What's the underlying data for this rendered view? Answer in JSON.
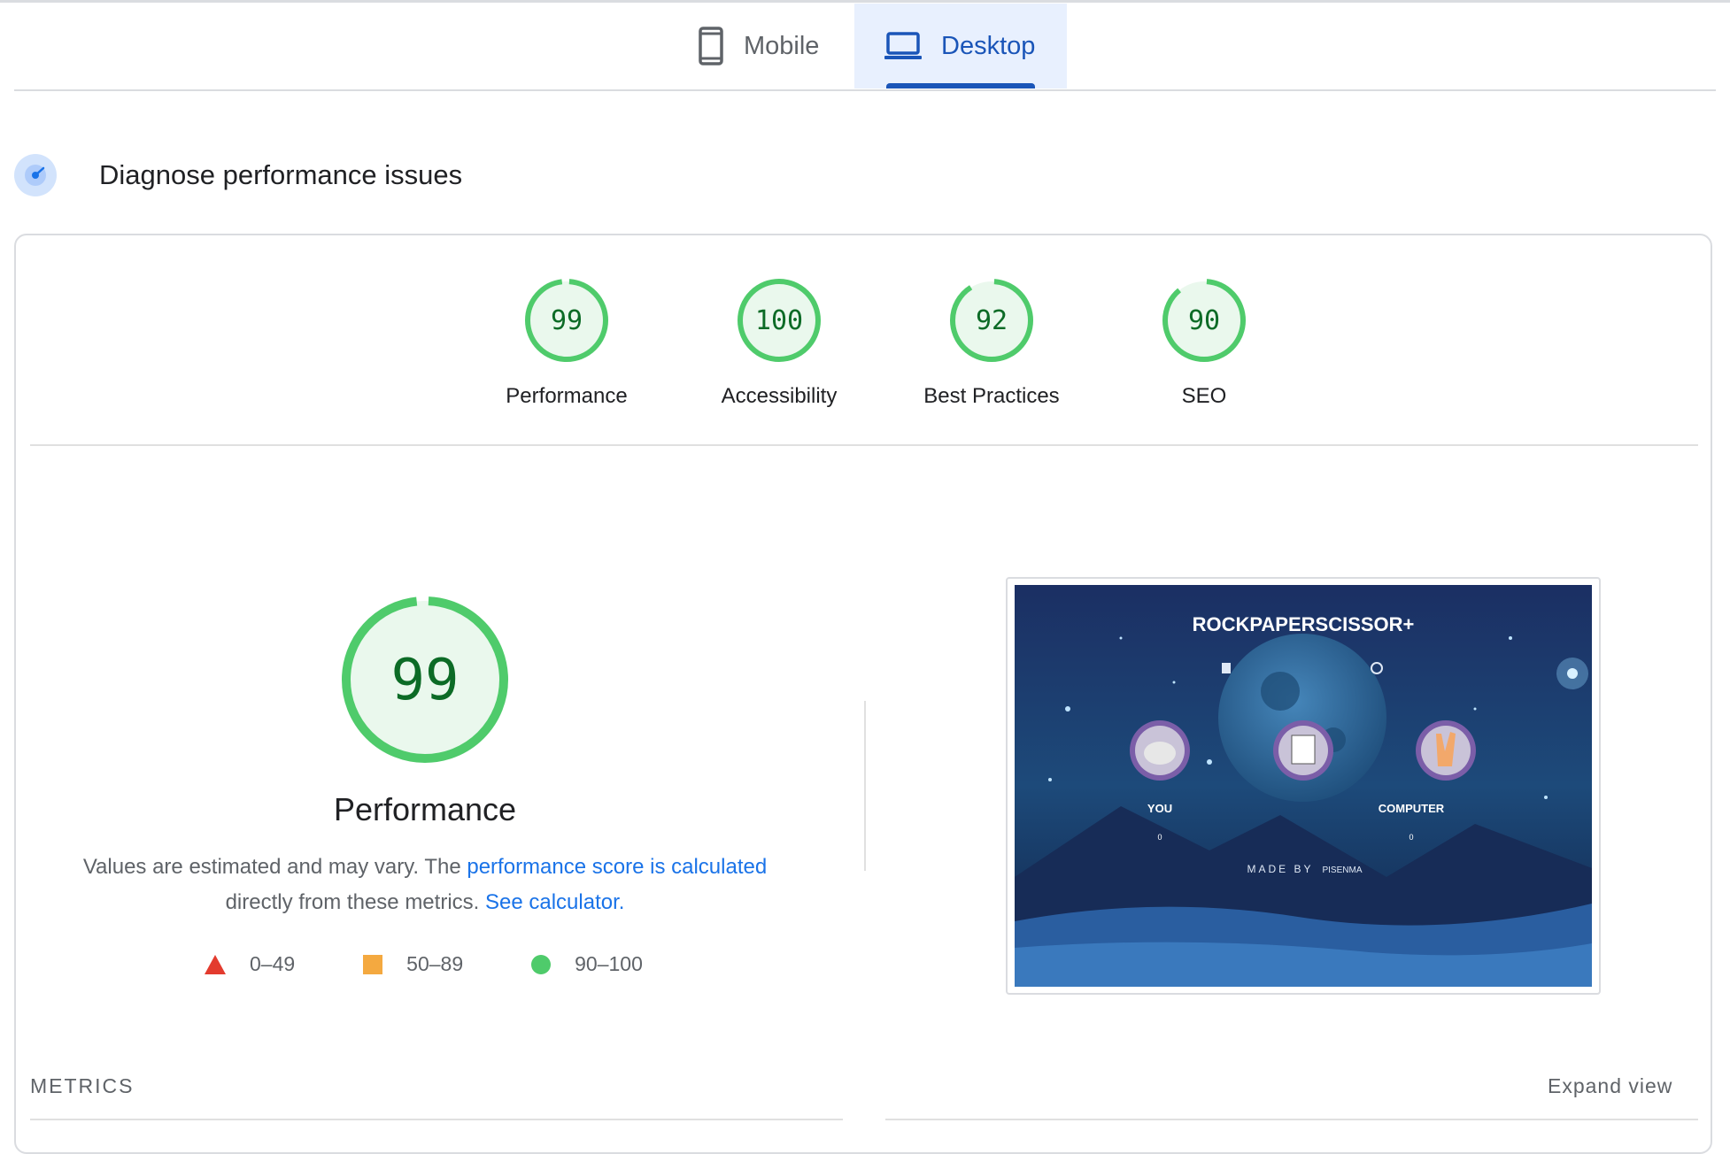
{
  "tabs": {
    "mobile": "Mobile",
    "desktop": "Desktop"
  },
  "diagnose": {
    "title": "Diagnose performance issues"
  },
  "scores": [
    {
      "value": "99",
      "label": "Performance",
      "score": 99
    },
    {
      "value": "100",
      "label": "Accessibility",
      "score": 100
    },
    {
      "value": "92",
      "label": "Best Practices",
      "score": 92
    },
    {
      "value": "90",
      "label": "SEO",
      "score": 90
    }
  ],
  "performance": {
    "score": "99",
    "title": "Performance",
    "desc_prefix": "Values are estimated and may vary. The ",
    "link1": "performance score is calculated",
    "desc_mid": "directly from these metrics. ",
    "link2": "See calculator."
  },
  "legend": {
    "fail": "0–49",
    "average": "50–89",
    "pass": "90–100"
  },
  "colors": {
    "pass": "#0c6b26",
    "pass_ring": "#4fcb6b",
    "pass_fill": "#eaf8ed",
    "average": "#f4a940",
    "fail": "#e33b2e",
    "accent": "#1a55b8",
    "link": "#1a73e8"
  },
  "thumbnail": {
    "title": "ROCKPAPERSCISSOR+",
    "you": "YOU",
    "computer": "COMPUTER",
    "you_score": "0",
    "computer_score": "0",
    "made_by": "MADE BY",
    "author": "PISENMA"
  },
  "metrics": {
    "label": "METRICS",
    "expand": "Expand view"
  }
}
